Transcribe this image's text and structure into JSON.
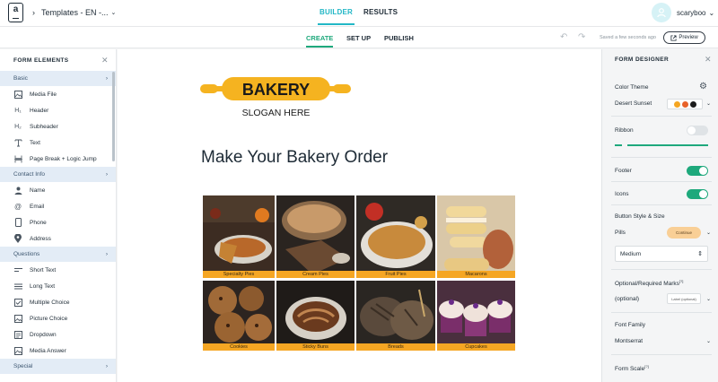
{
  "topbar": {
    "logo_letter": "a",
    "breadcrumb_title": "Templates - EN -...",
    "tabs": [
      {
        "label": "BUILDER",
        "active": true
      },
      {
        "label": "RESULTS",
        "active": false
      }
    ],
    "username": "scaryboo"
  },
  "subbar": {
    "tabs": [
      {
        "label": "CREATE",
        "active": true
      },
      {
        "label": "SET UP",
        "active": false
      },
      {
        "label": "PUBLISH",
        "active": false
      }
    ],
    "saved_status": "Saved a few seconds ago",
    "preview_label": "Preview"
  },
  "left_panel": {
    "title": "FORM ELEMENTS",
    "sections": [
      {
        "label": "Basic",
        "items": [
          {
            "label": "Media File",
            "icon": "image-icon"
          },
          {
            "label": "Header",
            "icon": "header1-icon"
          },
          {
            "label": "Subheader",
            "icon": "header2-icon"
          },
          {
            "label": "Text",
            "icon": "text-icon"
          },
          {
            "label": "Page Break + Logic Jump",
            "icon": "page-break-icon"
          }
        ]
      },
      {
        "label": "Contact Info",
        "items": [
          {
            "label": "Name",
            "icon": "person-icon"
          },
          {
            "label": "Email",
            "icon": "at-icon"
          },
          {
            "label": "Phone",
            "icon": "phone-icon"
          },
          {
            "label": "Address",
            "icon": "location-icon"
          }
        ]
      },
      {
        "label": "Questions",
        "items": [
          {
            "label": "Short Text",
            "icon": "short-text-icon"
          },
          {
            "label": "Long Text",
            "icon": "long-text-icon"
          },
          {
            "label": "Multiple Choice",
            "icon": "checkbox-icon"
          },
          {
            "label": "Picture Choice",
            "icon": "picture-choice-icon"
          },
          {
            "label": "Dropdown",
            "icon": "dropdown-icon"
          },
          {
            "label": "Media Answer",
            "icon": "media-answer-icon"
          }
        ]
      },
      {
        "label": "Special",
        "items": []
      }
    ]
  },
  "canvas": {
    "logo": {
      "brand": "BAKERY",
      "slogan": "SLOGAN HERE"
    },
    "form_title": "Make Your Bakery Order",
    "picture_choices": [
      "Specialty Pies",
      "Cream Pies",
      "Fruit Pies",
      "Macarons",
      "Cookies",
      "Sticky Buns",
      "Breads",
      "Cupcakes"
    ]
  },
  "right_panel": {
    "title": "FORM DESIGNER",
    "color_theme_label": "Color Theme",
    "theme_name": "Desert Sunset",
    "theme_colors": [
      "#f5a623",
      "#e8622a",
      "#1b1b1b"
    ],
    "ribbon_label": "Ribbon",
    "ribbon_on": false,
    "footer_label": "Footer",
    "footer_on": true,
    "icons_label": "Icons",
    "icons_on": true,
    "button_style_label": "Button Style & Size",
    "button_shape": "Pills",
    "button_preview_text": "Continue",
    "button_size": "Medium",
    "marks_label": "Optional/Required Marks",
    "marks_sup": "[?]",
    "marks_value": "(optional)",
    "marks_preview_text": "Label (optional)",
    "font_family_label": "Font Family",
    "font_family_value": "Montserrat",
    "form_scale_label": "Form Scale",
    "form_scale_sup": "[?]"
  }
}
